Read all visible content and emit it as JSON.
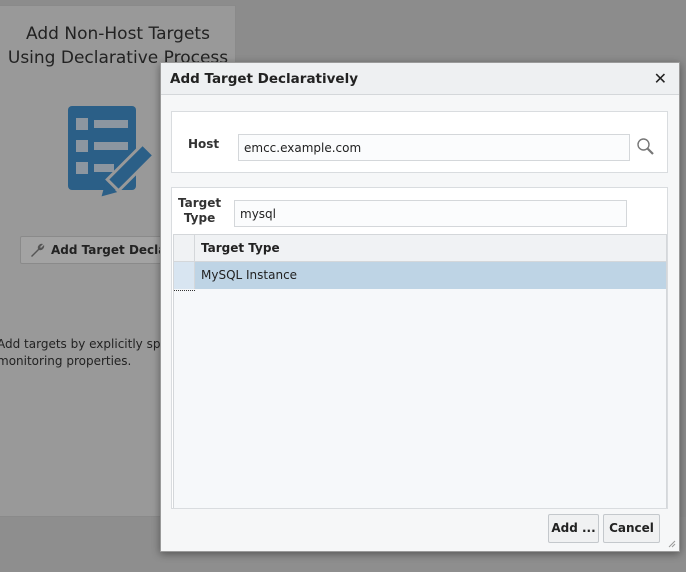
{
  "background": {
    "title_line1": "Add Non-Host Targets",
    "title_line2": "Using Declarative Process",
    "button_label": "Add Target Declaratively",
    "description_line1": "Add targets by explicitly specifying",
    "description_line2": "monitoring properties.",
    "icon": "form-edit-icon",
    "icon_color": "#2b5f87"
  },
  "dialog": {
    "title": "Add Target Declaratively",
    "close_label": "✕",
    "host": {
      "label": "Host",
      "value": "emcc.example.com"
    },
    "target_type": {
      "label_line1": "Target",
      "label_line2": "Type",
      "value": "mysql"
    },
    "table": {
      "columns": [
        "Target Type"
      ],
      "rows": [
        [
          "MySQL Instance"
        ]
      ],
      "selected_color": "#bed4e5"
    },
    "buttons": {
      "add": "Add ...",
      "cancel": "Cancel"
    }
  }
}
